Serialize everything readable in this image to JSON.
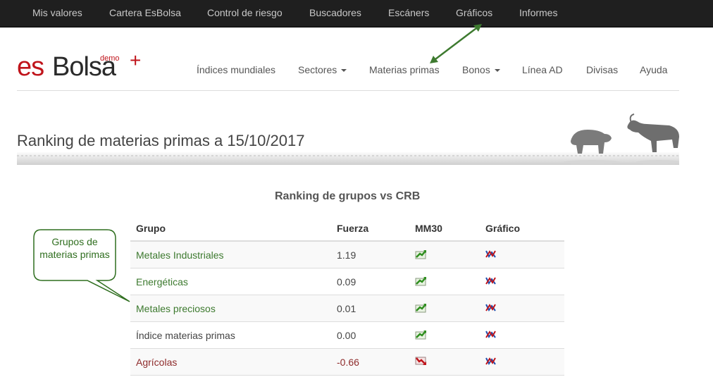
{
  "top_nav": {
    "items": [
      "Mis valores",
      "Cartera EsBolsa",
      "Control de riesgo",
      "Buscadores",
      "Escáners",
      "Gráficos",
      "Informes"
    ]
  },
  "logo": {
    "es": "es",
    "bolsa": "Bolsa",
    "demo": "demo",
    "plus": "+"
  },
  "main_nav": {
    "items": [
      "Índices mundiales",
      "Sectores",
      "Materias primas",
      "Bonos",
      "Línea AD",
      "Divisas",
      "Ayuda"
    ]
  },
  "page": {
    "title": "Ranking de materias primas a 15/10/2017"
  },
  "ranking": {
    "title": "Ranking de grupos vs CRB",
    "columns": [
      "Grupo",
      "Fuerza",
      "MM30",
      "Gráfico"
    ],
    "rows": [
      {
        "grupo": "Metales Industriales",
        "fuerza": "1.19",
        "mm30": "trend-up-icon"
      },
      {
        "grupo": "Energéticas",
        "fuerza": "0.09",
        "mm30": "trend-up-icon"
      },
      {
        "grupo": "Metales preciosos",
        "fuerza": "0.01",
        "mm30": "trend-up-icon"
      },
      {
        "grupo": "Índice materias primas",
        "fuerza": "0.00",
        "mm30": "trend-up-icon"
      },
      {
        "grupo": "Agrícolas",
        "fuerza": "-0.66",
        "mm30": "trend-down-icon"
      }
    ]
  },
  "callout": {
    "text": "Grupos de materias primas"
  },
  "colors": {
    "topbar": "#1f1f1f",
    "brand_red": "#c0141b",
    "link_green": "#3d7a2f",
    "negative": "#8e2b2b",
    "callout_border": "#2f6e1f"
  }
}
